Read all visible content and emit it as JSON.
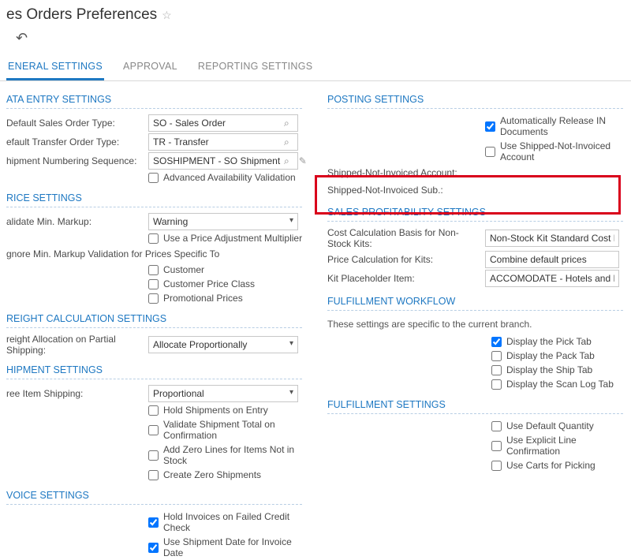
{
  "pageTitle": "es Orders Preferences",
  "tabs": {
    "general": "ENERAL SETTINGS",
    "approval": "APPROVAL",
    "reporting": "REPORTING SETTINGS"
  },
  "dataEntry": {
    "hdr": "ATA ENTRY SETTINGS",
    "defaultSalesOrderTypeLbl": "Default Sales Order Type:",
    "defaultSalesOrderType": "SO - Sales Order",
    "defaultTransferOrderTypeLbl": "efault Transfer Order Type:",
    "defaultTransferOrderType": "TR - Transfer",
    "shipmentNumSeqLbl": "hipment Numbering Sequence:",
    "shipmentNumSeq": "SOSHIPMENT - SO Shipment",
    "advancedAvailLbl": "Advanced Availability Validation"
  },
  "price": {
    "hdr": "RICE SETTINGS",
    "validateMinMarkupLbl": "alidate Min. Markup:",
    "validateMinMarkup": "Warning",
    "usePriceAdjLbl": "Use a Price Adjustment Multiplier",
    "ignoreLine": "gnore Min. Markup Validation for Prices Specific To",
    "customerLbl": "Customer",
    "custPriceClassLbl": "Customer Price Class",
    "promoLbl": "Promotional Prices"
  },
  "freight": {
    "hdr": "REIGHT CALCULATION SETTINGS",
    "freightAllocLbl": "reight Allocation on Partial Shipping:",
    "freightAlloc": "Allocate Proportionally"
  },
  "shipment": {
    "hdr": "HIPMENT SETTINGS",
    "freeItemShippingLbl": "ree Item Shipping:",
    "freeItemShipping": "Proportional",
    "holdEntryLbl": "Hold Shipments on Entry",
    "validateTotalLbl": "Validate Shipment Total on Confirmation",
    "addZeroLinesLbl": "Add Zero Lines for Items Not in Stock",
    "createZeroLbl": "Create Zero Shipments"
  },
  "invoice": {
    "hdr": "VOICE SETTINGS",
    "holdInvoicesLbl": "Hold Invoices on Failed Credit Check",
    "useShipDateLbl": "Use Shipment Date for Invoice Date"
  },
  "posting": {
    "hdr": "POSTING SETTINGS",
    "autoReleaseLbl": "Automatically Release IN Documents",
    "useShippedNotInvLbl": "Use Shipped-Not-Invoiced Account",
    "sniAccountLbl": "Shipped-Not-Invoiced Account:",
    "sniSubLbl": "Shipped-Not-Invoiced Sub.:"
  },
  "profitability": {
    "hdr": "SALES PROFITABILITY SETTINGS",
    "costCalcLbl": "Cost Calculation Basis for Non-Stock Kits:",
    "costCalc": "Non-Stock Kit Standard Cost Plus Sto",
    "priceCalcLbl": "Price Calculation for Kits:",
    "priceCalc": "Combine default prices",
    "kitPlaceholderLbl": "Kit Placeholder Item:",
    "kitPlaceholder": "ACCOMODATE - Hotels and Lodging"
  },
  "fulfillWorkflow": {
    "hdr": "FULFILLMENT WORKFLOW",
    "note": "These settings are specific to the current branch.",
    "pickLbl": "Display the Pick Tab",
    "packLbl": "Display the Pack Tab",
    "shipLbl": "Display the Ship Tab",
    "scanLbl": "Display the Scan Log Tab"
  },
  "fulfillSettings": {
    "hdr": "FULFILLMENT SETTINGS",
    "defaultQtyLbl": "Use Default Quantity",
    "explicitLbl": "Use Explicit Line Confirmation",
    "cartsLbl": "Use Carts for Picking"
  }
}
